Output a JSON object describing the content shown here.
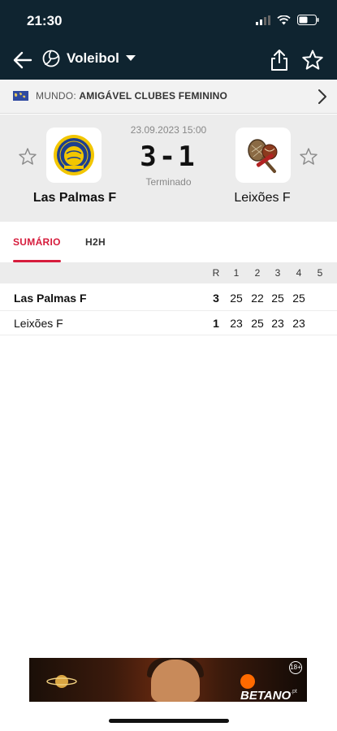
{
  "status_bar": {
    "time": "21:30"
  },
  "header": {
    "sport": "Voleibol"
  },
  "competition": {
    "region": "MUNDO:",
    "league": "AMIGÁVEL CLUBES FEMININO"
  },
  "match": {
    "datetime": "23.09.2023 15:00",
    "score": "3-1",
    "status": "Terminado",
    "home": {
      "name": "Las Palmas F"
    },
    "away": {
      "name": "Leixões F"
    }
  },
  "tabs": [
    {
      "label": "SUMÁRIO",
      "active": true
    },
    {
      "label": "H2H",
      "active": false
    }
  ],
  "score_table": {
    "headers": [
      "R",
      "1",
      "2",
      "3",
      "4",
      "5"
    ],
    "rows": [
      {
        "team": "Las Palmas F",
        "winner": true,
        "values": [
          "3",
          "25",
          "22",
          "25",
          "25",
          ""
        ]
      },
      {
        "team": "Leixões F",
        "winner": false,
        "values": [
          "1",
          "23",
          "25",
          "23",
          "23",
          ""
        ]
      }
    ]
  },
  "ad": {
    "brand": "BETANO",
    "tld": ".pt",
    "age": "18+"
  },
  "colors": {
    "header_bg": "#0f2430",
    "accent": "#d61c3c",
    "match_bg": "#ececec"
  }
}
